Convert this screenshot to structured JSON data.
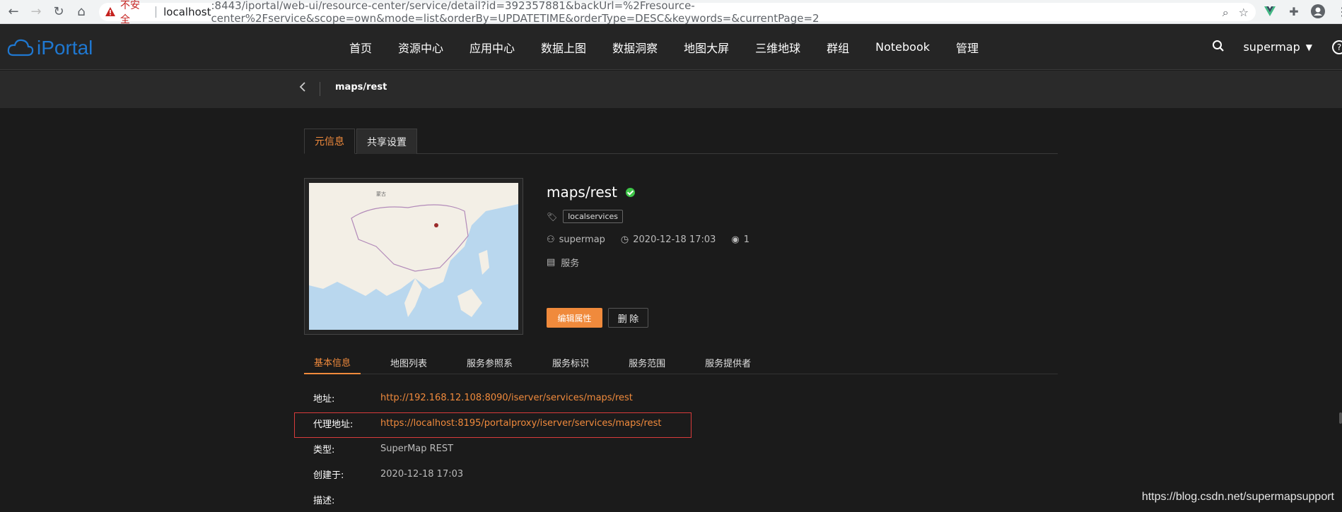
{
  "browser": {
    "insecure_label": "不安全",
    "url_host": "localhost",
    "url_rest": ":8443/iportal/web-ui/resource-center/service/detail?id=392357881&backUrl=%2Fresource-center%2Fservice&scope=own&mode=list&orderBy=UPDATETIME&orderType=DESC&keywords=&currentPage=2"
  },
  "header": {
    "logo_text": "iPortal",
    "nav": [
      "首页",
      "资源中心",
      "应用中心",
      "数据上图",
      "数据洞察",
      "地图大屏",
      "三维地球",
      "群组",
      "Notebook",
      "管理"
    ],
    "user": "supermap"
  },
  "breadcrumb": {
    "title": "maps/rest"
  },
  "top_tabs": [
    "元信息",
    "共享设置"
  ],
  "meta": {
    "title": "maps/rest",
    "tag": "localservices",
    "owner": "supermap",
    "created": "2020-12-18 17:03",
    "views": "1",
    "type": "服务",
    "edit_label": "编辑属性",
    "delete_label": "删 除"
  },
  "info_tabs": [
    "基本信息",
    "地图列表",
    "服务参照系",
    "服务标识",
    "服务范围",
    "服务提供者"
  ],
  "info": [
    {
      "label": "地址:",
      "value": "http://192.168.12.108:8090/iserver/services/maps/rest"
    },
    {
      "label": "代理地址:",
      "value": "https://localhost:8195/portalproxy/iserver/services/maps/rest"
    },
    {
      "label": "类型:",
      "value": "SuperMap REST"
    },
    {
      "label": "创建于:",
      "value": "2020-12-18 17:03"
    },
    {
      "label": "描述:",
      "value": ""
    }
  ],
  "watermark": "https://blog.csdn.net/supermapsupport",
  "colors": {
    "accent": "#f08a3c",
    "success": "#3ec548",
    "brand": "#1f78d1"
  }
}
